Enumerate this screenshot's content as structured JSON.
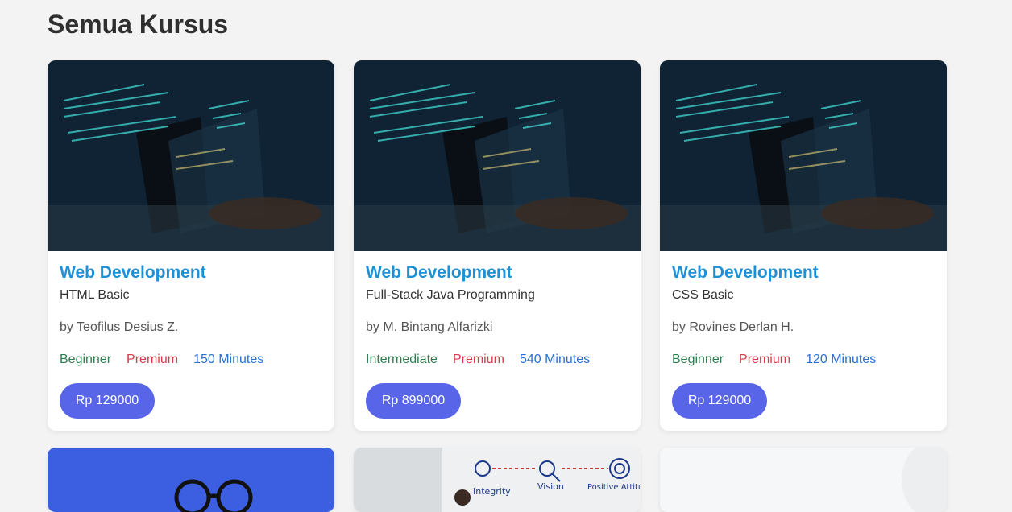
{
  "page": {
    "title": "Semua Kursus"
  },
  "courses": [
    {
      "category": "Web Development",
      "name": "HTML Basic",
      "author": "by Teofilus Desius Z.",
      "level": "Beginner",
      "tier": "Premium",
      "duration": "150 Minutes",
      "price": "Rp 129000"
    },
    {
      "category": "Web Development",
      "name": "Full-Stack Java Programming",
      "author": "by M. Bintang Alfarizki",
      "level": "Intermediate",
      "tier": "Premium",
      "duration": "540 Minutes",
      "price": "Rp 899000"
    },
    {
      "category": "Web Development",
      "name": "CSS Basic",
      "author": "by Rovines Derlan H.",
      "level": "Beginner",
      "tier": "Premium",
      "duration": "120 Minutes",
      "price": "Rp 129000"
    }
  ],
  "partial_cards": {
    "card2_labels": [
      "Integrity",
      "Vision",
      "Positive Attitude"
    ]
  },
  "colors": {
    "accent": "#1e90d6",
    "button": "#5865e8",
    "beginner": "#2e7d4f",
    "premium": "#d93a4a",
    "duration": "#2a6fd1"
  }
}
